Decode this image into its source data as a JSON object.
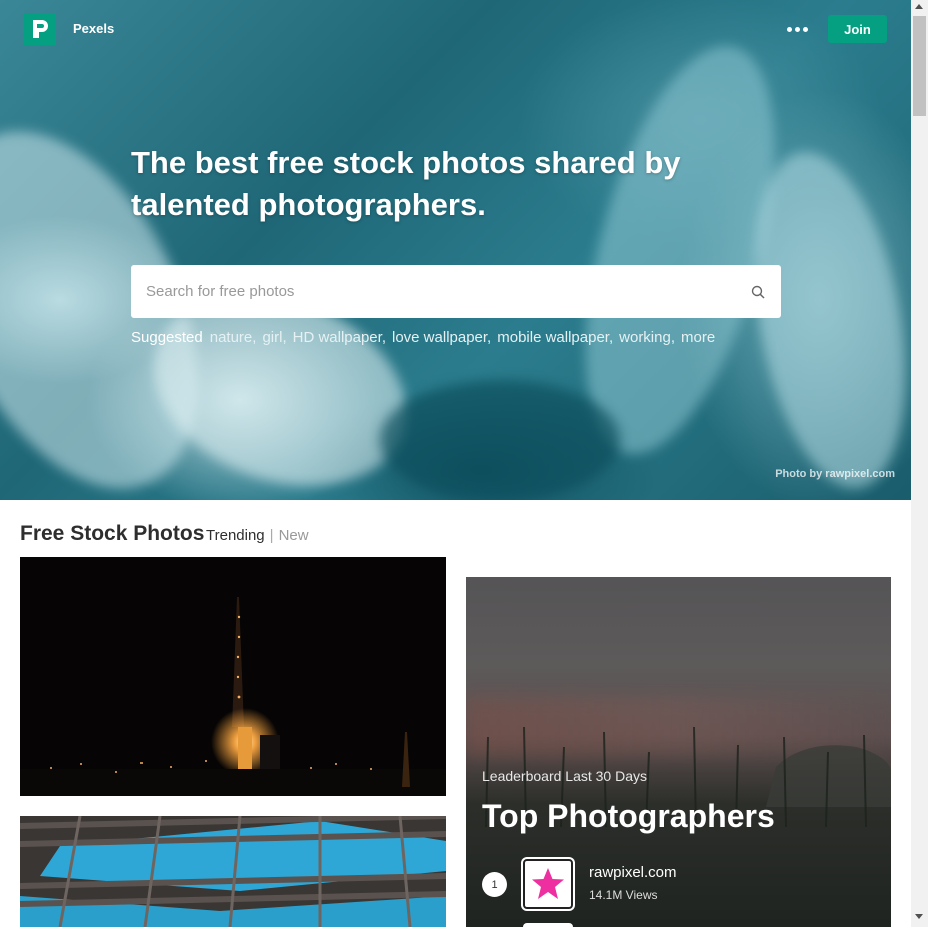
{
  "header": {
    "brand": "Pexels",
    "join_label": "Join",
    "accent_color": "#05a081"
  },
  "hero": {
    "headline": "The best free stock photos shared by talented photographers.",
    "search_placeholder": "Search for free photos",
    "suggested_label": "Suggested",
    "suggestions": [
      "nature,",
      "girl,",
      "HD wallpaper,",
      "love wallpaper,",
      "mobile wallpaper,",
      "working,",
      "more"
    ],
    "credit": "Photo by rawpixel.com"
  },
  "section": {
    "title": "Free Stock Photos",
    "tab_trending": "Trending",
    "tab_separator": "|",
    "tab_new": "New"
  },
  "leaderboard": {
    "subtitle": "Leaderboard Last 30 Days",
    "title": "Top Photographers",
    "entries": [
      {
        "rank": "1",
        "name": "rawpixel.com",
        "views": "14.1M Views"
      }
    ]
  },
  "icons": {
    "logo": "pexels-logo-icon",
    "more": "more-dots-icon",
    "search": "search-icon",
    "avatar": "star-avatar-icon"
  }
}
